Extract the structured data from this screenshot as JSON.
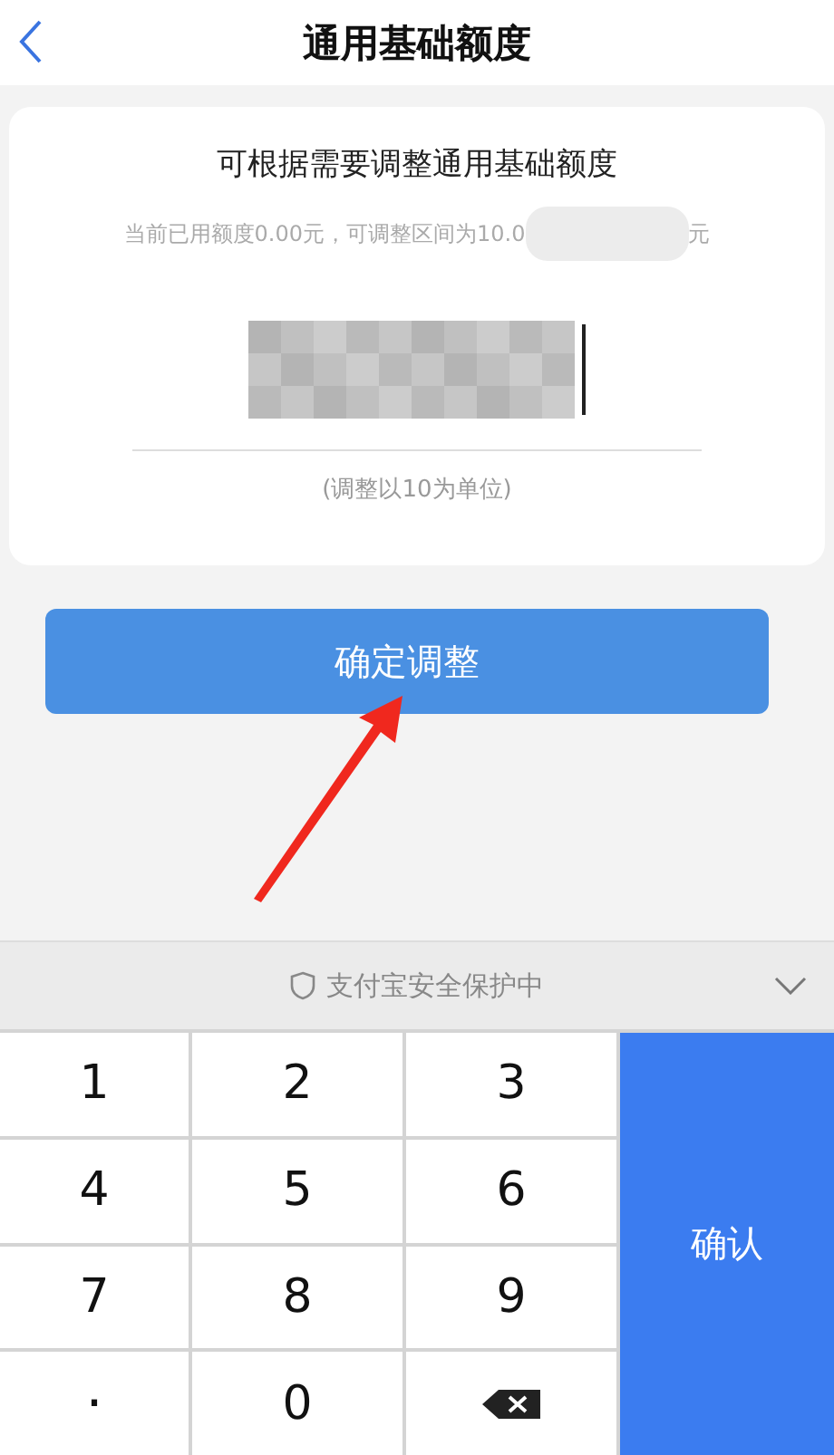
{
  "header": {
    "title": "通用基础额度"
  },
  "card": {
    "heading": "可根据需要调整通用基础额度",
    "note_start": "当前已用额度0.00元，可调整区间为10.0",
    "note_end": "元",
    "hint": "(调整以10为单位)"
  },
  "confirm_button": "确定调整",
  "keyboard": {
    "banner": "支付宝安全保护中",
    "confirm": "确认",
    "keys": [
      {
        "kind": "digit",
        "label": "1"
      },
      {
        "kind": "digit",
        "label": "2"
      },
      {
        "kind": "digit",
        "label": "3"
      },
      {
        "kind": "digit",
        "label": "4"
      },
      {
        "kind": "digit",
        "label": "5"
      },
      {
        "kind": "digit",
        "label": "6"
      },
      {
        "kind": "digit",
        "label": "7"
      },
      {
        "kind": "digit",
        "label": "8"
      },
      {
        "kind": "digit",
        "label": "9"
      },
      {
        "kind": "symbol",
        "label": "."
      },
      {
        "kind": "digit",
        "label": "0"
      },
      {
        "kind": "backspace"
      }
    ]
  }
}
